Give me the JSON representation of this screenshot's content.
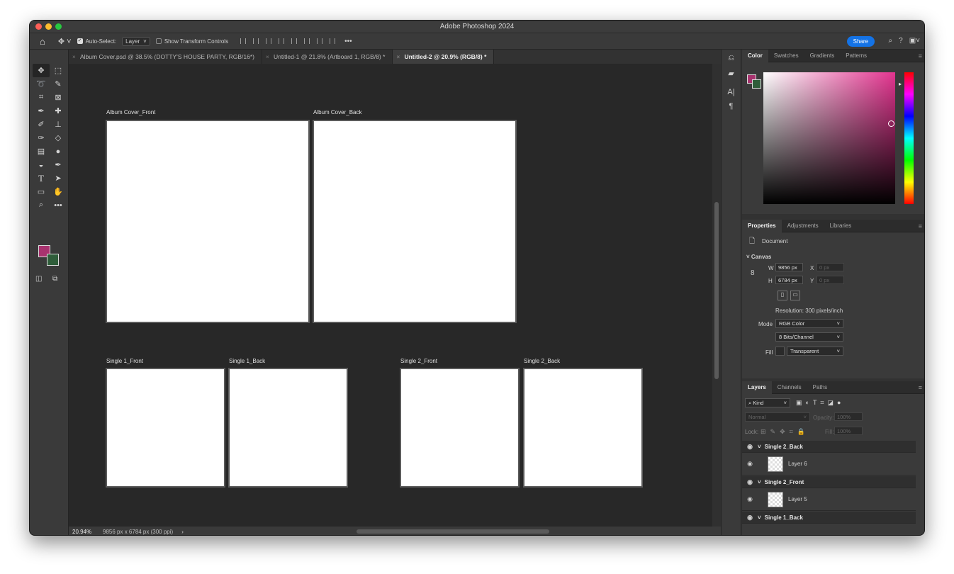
{
  "app": {
    "title": "Adobe Photoshop 2024"
  },
  "options_bar": {
    "auto_select_label": "Auto-Select:",
    "auto_select_value": "Layer",
    "show_transform_label": "Show Transform Controls",
    "more_label": "•••",
    "share_label": "Share"
  },
  "tabs": [
    {
      "label": "Album Cover.psd @ 38.5% (DOTTY'S HOUSE PARTY, RGB/16*)"
    },
    {
      "label": "Untitled-1 @ 21.8% (Artboard 1, RGB/8) *"
    },
    {
      "label": "Untitled-2 @ 20.9% (RGB/8) *"
    }
  ],
  "artboards": [
    {
      "label": "Album Cover_Front"
    },
    {
      "label": "Album Cover_Back"
    },
    {
      "label": "Single 1_Front"
    },
    {
      "label": "Single 1_Back"
    },
    {
      "label": "Single 2_Front"
    },
    {
      "label": "Single 2_Back"
    }
  ],
  "status": {
    "zoom": "20.94%",
    "doc_info": "9856 px x 6784 px (300 ppi)",
    "arrow": "›"
  },
  "color_panel": {
    "tabs": [
      "Color",
      "Swatches",
      "Gradients",
      "Patterns"
    ],
    "foreground": "#a8336f",
    "background": "#2f5d3a"
  },
  "properties_panel": {
    "tabs": [
      "Properties",
      "Adjustments",
      "Libraries"
    ],
    "doc_label": "Document",
    "canvas_label": "Canvas",
    "w_label": "W",
    "w_value": "9856 px",
    "h_label": "H",
    "h_value": "6784 px",
    "x_label": "X",
    "x_value": "0 px",
    "y_label": "Y",
    "y_value": "0 px",
    "resolution": "Resolution: 300 pixels/inch",
    "mode_label": "Mode",
    "mode_value": "RGB Color",
    "bits_value": "8 Bits/Channel",
    "fill_label": "Fill",
    "fill_value": "Transparent"
  },
  "layers_panel": {
    "tabs": [
      "Layers",
      "Channels",
      "Paths"
    ],
    "kind_label": "Kind",
    "blend_mode": "Normal",
    "opacity_label": "Opacity:",
    "opacity_value": "100%",
    "lock_label": "Lock:",
    "fill_label": "Fill:",
    "fill_value": "100%",
    "rows": [
      {
        "label": "Single 2_Back",
        "type": "group"
      },
      {
        "label": "Layer 6",
        "type": "layer"
      },
      {
        "label": "Single 2_Front",
        "type": "group"
      },
      {
        "label": "Layer 5",
        "type": "layer"
      },
      {
        "label": "Single 1_Back",
        "type": "group"
      }
    ]
  }
}
